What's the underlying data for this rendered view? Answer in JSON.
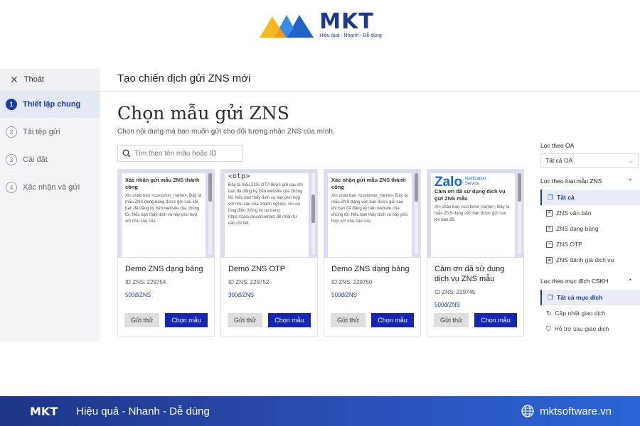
{
  "logo": {
    "brand": "MKT",
    "tagline": "Hiệu quả - Nhanh - Dễ dùng"
  },
  "sidebar": {
    "exit_label": "Thoát",
    "steps": [
      {
        "num": "1",
        "label": "Thiết lập chung"
      },
      {
        "num": "2",
        "label": "Tải tệp gửi"
      },
      {
        "num": "3",
        "label": "Cài đặt"
      },
      {
        "num": "4",
        "label": "Xác nhận và gửi"
      }
    ]
  },
  "header": {
    "title": "Tạo chiến dịch gửi ZNS mới"
  },
  "main": {
    "title": "Chọn mẫu gửi ZNS",
    "subtitle": "Chọn nội dung mà bạn muốn gửi cho đối tượng nhận ZNS của mình.",
    "search_placeholder": "Tìm theo tên mẫu hoặc ID"
  },
  "cards": [
    {
      "preview_title": "Xác nhận gửi mẫu ZNS thành công",
      "preview_text": "Xin chào bạn <customer_name>. Đây là mẫu ZNS dạng bảng được gửi sau khi bạn đã đăng ký trên website của chúng tôi. Nếu bạn thấy dịch vụ này phù hợp với nhu cầu của",
      "name": "Demo ZNS dạng bảng",
      "id": "ID ZNS: 229754",
      "price": "500đ/ZNS",
      "try_label": "Gửi thử",
      "choose_label": "Chọn mẫu"
    },
    {
      "preview_title": "<otp>",
      "preview_text": "Đây là mẫu ZNS OTP được gửi sau khi bạn đã đăng ký trên website của chúng tôi. Nếu bạn thấy dịch vụ này phù hợp với nhu cầu của doanh nghiệp, xin vui lòng điền thông tin tại trang https://zalo.cloud/contact để nhận tư vấn chi tiết.",
      "name": "Demo ZNS OTP",
      "id": "ID ZNS: 229752",
      "price": "300đ/ZNS",
      "try_label": "Gửi thử",
      "choose_label": "Chọn mẫu"
    },
    {
      "preview_title": "Xác nhận gửi mẫu ZNS thành công",
      "preview_text": "Xin chào bạn <customer_name>. Đây là mẫu ZNS dạng văn bản được gửi sau khi bạn đã đăng ký trên website của chúng tôi. Nếu bạn thấy dịch vụ này phù hợp với nhu cầu của",
      "name": "Demo ZNS dạng bảng",
      "id": "ID ZNS: 229750",
      "price": "500đ/ZNS",
      "try_label": "Gửi thử",
      "choose_label": "Chọn mẫu"
    },
    {
      "zalo_brand": "Zalo",
      "zalo_sub": "Notification Service",
      "preview_title": "Cảm ơn đã sử dụng dịch vụ gửi ZNS mẫu",
      "preview_text": "Xin chào bạn <custome_name>, Đây là mẫu ZNS dạng văn bản được gửi sau khi bạn đã",
      "name": "Cảm ơn đã sử dụng dịch vụ ZNS mẫu",
      "id": "ID ZNS: 229745",
      "price": "500đ/ZNS",
      "try_label": "Gửi thử",
      "choose_label": "Chọn mẫu"
    }
  ],
  "filters": {
    "oa_label": "Lọc theo OA",
    "oa_value": "Tất cả OA",
    "type_label": "Lọc theo loại mẫu ZNS",
    "type_items": [
      "Tất cả",
      "ZNS văn bản",
      "ZNS dạng bảng",
      "ZNS OTP",
      "ZNS đánh giá dịch vụ"
    ],
    "purpose_label": "Lọc theo mục đích CSKH",
    "purpose_items": [
      "Tất cả mục đích",
      "Cập nhật giao dịch",
      "Hỗ trợ sau giao dịch"
    ]
  },
  "footer": {
    "logo": "MKT",
    "slogan": "Hiệu quả - Nhanh - Dễ dùng",
    "website": "mktsoftware.vn"
  },
  "colors": {
    "primary": "#1626b4",
    "footer_bg": "#1d3586",
    "logo_blue": "#1d3a8a",
    "logo_yellow": "#f5b81f"
  }
}
